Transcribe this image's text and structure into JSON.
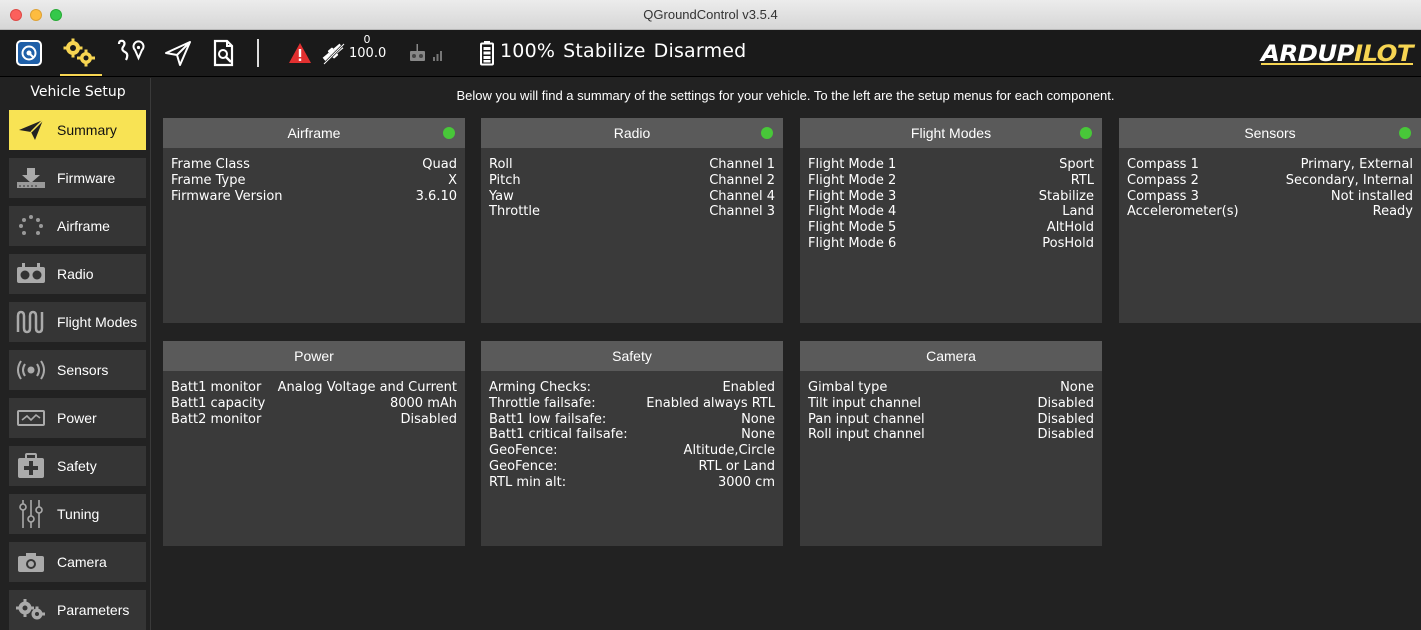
{
  "window": {
    "title": "QGroundControl v3.5.4"
  },
  "toolbar": {
    "gps_count": "0",
    "gps_hdop": "100.0",
    "battery": "100%",
    "flight_mode": "Stabilize",
    "arm_state": "Disarmed",
    "brand": "ARDUPILOT",
    "accent_color": "#f7d552"
  },
  "sidebar": {
    "header": "Vehicle Setup",
    "items": [
      {
        "label": "Summary",
        "icon": "paper-plane-icon",
        "active": true
      },
      {
        "label": "Firmware",
        "icon": "download-icon"
      },
      {
        "label": "Airframe",
        "icon": "airframe-dots-icon"
      },
      {
        "label": "Radio",
        "icon": "radio-transmitter-icon"
      },
      {
        "label": "Flight Modes",
        "icon": "waveform-icon"
      },
      {
        "label": "Sensors",
        "icon": "sensor-signal-icon"
      },
      {
        "label": "Power",
        "icon": "power-gauge-icon"
      },
      {
        "label": "Safety",
        "icon": "first-aid-icon"
      },
      {
        "label": "Tuning",
        "icon": "sliders-icon"
      },
      {
        "label": "Camera",
        "icon": "camera-icon"
      },
      {
        "label": "Parameters",
        "icon": "gears-icon"
      }
    ]
  },
  "main": {
    "intro": "Below you will find a summary of the settings for your vehicle. To the left are the setup menus for each component.",
    "cards": [
      {
        "title": "Airframe",
        "status": true,
        "rows": [
          [
            "Frame Class",
            "Quad"
          ],
          [
            "Frame Type",
            "X"
          ],
          [
            "Firmware Version",
            "3.6.10"
          ]
        ]
      },
      {
        "title": "Radio",
        "status": true,
        "rows": [
          [
            "Roll",
            "Channel 1"
          ],
          [
            "Pitch",
            "Channel 2"
          ],
          [
            "Yaw",
            "Channel 4"
          ],
          [
            "Throttle",
            "Channel 3"
          ]
        ]
      },
      {
        "title": "Flight Modes",
        "status": true,
        "rows": [
          [
            "Flight Mode 1",
            "Sport"
          ],
          [
            "Flight Mode 2",
            "RTL"
          ],
          [
            "Flight Mode 3",
            "Stabilize"
          ],
          [
            "Flight Mode 4",
            "Land"
          ],
          [
            "Flight Mode 5",
            "AltHold"
          ],
          [
            "Flight Mode 6",
            "PosHold"
          ]
        ]
      },
      {
        "title": "Sensors",
        "status": true,
        "rows": [
          [
            "Compass 1",
            "Primary, External"
          ],
          [
            "Compass 2",
            "Secondary, Internal"
          ],
          [
            "Compass 3",
            "Not installed"
          ],
          [
            "Accelerometer(s)",
            "Ready"
          ]
        ]
      },
      {
        "title": "Power",
        "status": false,
        "rows": [
          [
            "Batt1 monitor",
            "Analog Voltage and Current"
          ],
          [
            "Batt1 capacity",
            "8000 mAh"
          ],
          [
            "Batt2 monitor",
            "Disabled"
          ]
        ]
      },
      {
        "title": "Safety",
        "status": false,
        "rows": [
          [
            "Arming Checks:",
            "Enabled"
          ],
          [
            "Throttle failsafe:",
            "Enabled always RTL"
          ],
          [
            "Batt1 low failsafe:",
            "None"
          ],
          [
            "Batt1 critical failsafe:",
            "None"
          ],
          [
            "GeoFence:",
            "Altitude,Circle"
          ],
          [
            "GeoFence:",
            "RTL or Land"
          ],
          [
            "RTL min alt:",
            "3000 cm"
          ]
        ]
      },
      {
        "title": "Camera",
        "status": false,
        "rows": [
          [
            "Gimbal type",
            "None"
          ],
          [
            "Tilt input channel",
            "Disabled"
          ],
          [
            "Pan input channel",
            "Disabled"
          ],
          [
            "Roll input channel",
            "Disabled"
          ]
        ]
      }
    ]
  }
}
